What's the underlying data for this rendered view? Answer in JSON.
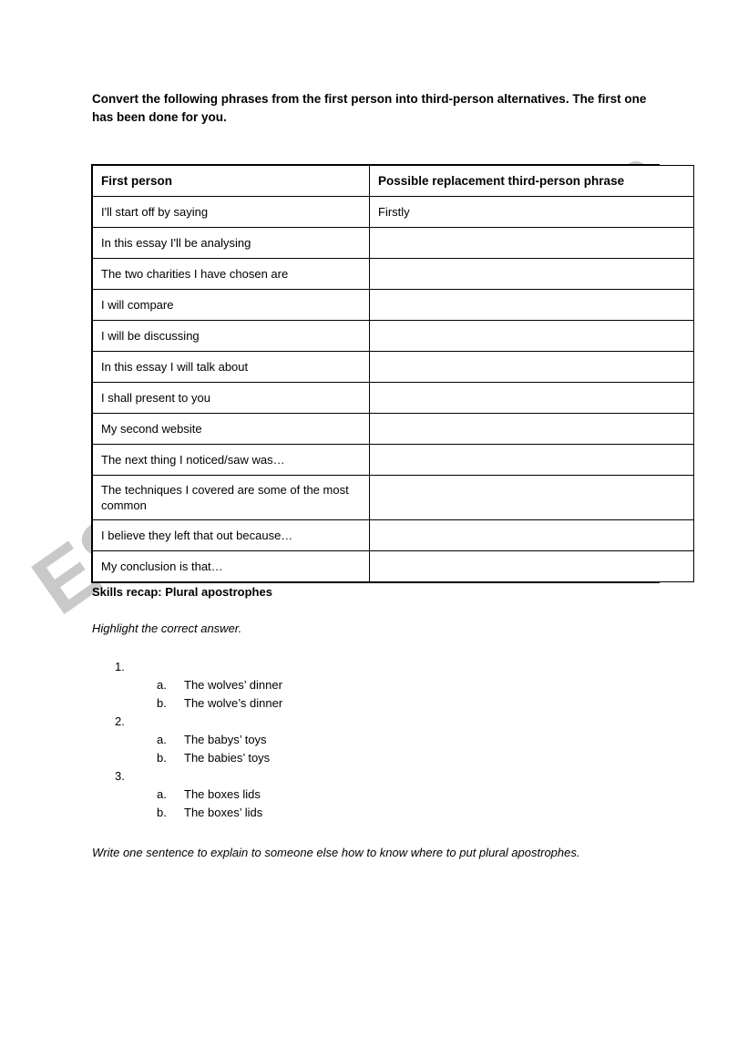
{
  "document": {
    "intro": "Convert the following phrases from the first person into third-person alternatives. The first one has been done for you.",
    "watermark": "ESLprintables.com"
  },
  "table": {
    "headers": {
      "first_person": "First person",
      "replacement": "Possible replacement third-person phrase"
    },
    "rows": [
      {
        "first_person": "I'll start off by saying",
        "replacement": "Firstly"
      },
      {
        "first_person": "In this essay I'll be analysing",
        "replacement": ""
      },
      {
        "first_person": "The two charities I have chosen are",
        "replacement": ""
      },
      {
        "first_person": "I will compare",
        "replacement": ""
      },
      {
        "first_person": "I will be discussing",
        "replacement": ""
      },
      {
        "first_person": "In this essay I will talk about",
        "replacement": ""
      },
      {
        "first_person": "I shall present to you",
        "replacement": ""
      },
      {
        "first_person": "My second website",
        "replacement": ""
      },
      {
        "first_person": "The next thing I noticed/saw was…",
        "replacement": ""
      },
      {
        "first_person": "The techniques I covered are some of the most common",
        "replacement": ""
      },
      {
        "first_person": "I believe they left that out because…",
        "replacement": ""
      },
      {
        "first_person": "My conclusion is that…",
        "replacement": ""
      }
    ]
  },
  "recap": {
    "heading": "Skills recap: Plural apostrophes",
    "instruction": "Highlight the correct answer.",
    "questions": [
      {
        "number": "1.",
        "options": [
          {
            "letter": "a.",
            "text": "The wolves’ dinner"
          },
          {
            "letter": "b.",
            "text": "The wolve’s dinner"
          }
        ]
      },
      {
        "number": "2.",
        "options": [
          {
            "letter": "a.",
            "text": "The babys’ toys"
          },
          {
            "letter": "b.",
            "text": "The babies’ toys"
          }
        ]
      },
      {
        "number": "3.",
        "options": [
          {
            "letter": "a.",
            "text": "The boxes lids"
          },
          {
            "letter": "b.",
            "text": "The boxes’ lids"
          }
        ]
      }
    ],
    "closing_instruction": "Write one sentence to explain to someone else how to know where to put plural apostrophes."
  }
}
